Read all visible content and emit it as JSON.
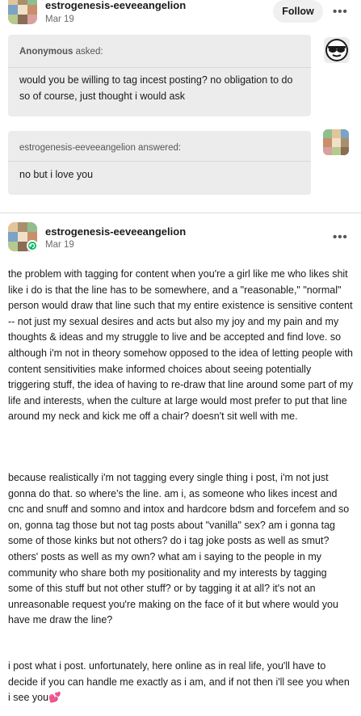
{
  "post1": {
    "username": "estrogenesis-eeveeangelion",
    "date": "Mar 19",
    "follow_label": "Follow",
    "more_label": "•••",
    "ask": {
      "asker": "Anonymous",
      "asked_suffix": " asked:",
      "question": "would you be willing to tag incest posting? no obligation to do so of course, just thought i would ask"
    },
    "answer": {
      "answerer": "estrogenesis-eeveeangelion",
      "answered_suffix": " answered:",
      "text": "no but i love you"
    }
  },
  "post2": {
    "username": "estrogenesis-eeveeangelion",
    "date": "Mar 19",
    "more_label": "•••",
    "paragraphs": [
      "the problem with tagging for content when you're a girl like me who likes shit like i do is that the line has to be somewhere, and a \"reasonable,\" \"normal\" person would draw that line such that my entire existence is sensitive content -- not just my sexual desires and acts but also my joy and my pain and my thoughts & ideas and my struggle to live and be accepted and find love. so although i'm not in theory somehow opposed to the idea of letting people with content sensitivities make informed choices about seeing potentially triggering stuff, the idea of having to re-draw that line around some part of my life and interests, when the culture at large would most prefer to put that line around my neck and kick me off a chair? doesn't sit well with me.",
      "because realistically i'm not tagging every single thing i post, i'm not just gonna do that. so where's the line. am i, as someone who likes incest and cnc and snuff and somno and intox and hardcore bdsm and forcefem and so on, gonna tag those but not tag posts about \"vanilla\" sex? am i gonna tag some of those kinks but not others? do i tag joke posts as well as smut? others' posts as well as my own? what am i saying to the people in my community who share both my positionality and my interests by tagging some of this stuff but not other stuff? or by tagging it at all? it's not an unreasonable request you're making on the face of it but where would you have me draw the line?",
      "i post what i post. unfortunately, here online as in real life, you'll have to decide if you can handle me exactly as i am, and if not then i'll see you when i see you💕"
    ]
  },
  "icons": {
    "avatar": "user-avatar-icon",
    "anon": "anonymous-sunglasses-icon",
    "badge": "green-refresh-badge-icon"
  }
}
